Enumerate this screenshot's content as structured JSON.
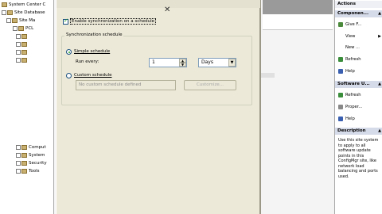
{
  "tree": {
    "root": "System Center C",
    "site_database": "Site Database",
    "site_management": "Site Ma",
    "pcl": "PCL",
    "bottom_items": [
      "Comput",
      "System",
      "Security",
      "Tools"
    ]
  },
  "dialog": {
    "enable_label": "Enable synchronization on a schedule",
    "group_title": "Synchronization schedule",
    "simple_label": "Simple schedule",
    "run_every_label": "Run every:",
    "run_every_value": "1",
    "unit_value": "Days",
    "custom_label": "Custom schedule",
    "custom_placeholder": "No custom schedule defined",
    "customize_label": "Customize..."
  },
  "actions": {
    "title": "Actions",
    "section1": "Componen...",
    "section1_items": [
      "Give F...",
      "View",
      "New ...",
      "Refresh",
      "Help"
    ],
    "section2": "Software U...",
    "section2_items": [
      "Refresh",
      "Proper...",
      "Help"
    ],
    "section3": "Description",
    "description": "Use this site system to apply to all software update points in this ConfigMgr site, like network load balancing and ports used."
  }
}
